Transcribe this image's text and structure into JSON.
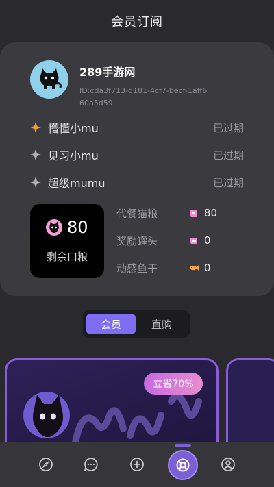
{
  "header": {
    "title": "会员订阅"
  },
  "profile": {
    "username": "289手游网",
    "user_id": "ID:cda3f713-d181-4cf7-becf-1aff660a5d59",
    "avatar_icon": "black-cat-avatar"
  },
  "tiers": [
    {
      "name": "懵懂小mu",
      "status": "已过期",
      "icon": "orange-star-icon"
    },
    {
      "name": "见习小mu",
      "status": "已过期",
      "icon": "grey-star-icon"
    },
    {
      "name": "超级mumu",
      "status": "已过期",
      "icon": "grey-star-icon"
    }
  ],
  "food": {
    "count": "80",
    "label": "剩余口粮"
  },
  "stats": [
    {
      "label": "代餐猫粮",
      "value": "80",
      "icon": "cat-food-icon"
    },
    {
      "label": "奖励罐头",
      "value": "0",
      "icon": "can-icon"
    },
    {
      "label": "动感鱼干",
      "value": "0",
      "icon": "fish-icon"
    }
  ],
  "tabs": {
    "active": "会员",
    "other": "直购"
  },
  "promo": {
    "badge": "立省70%"
  },
  "nav": {
    "items": [
      "compass-icon",
      "chat-icon",
      "plus-icon",
      "lifebuoy-icon",
      "profile-icon"
    ]
  },
  "colors": {
    "accent": "#7f6cf0",
    "badge_start": "#c76ae0",
    "badge_end": "#e88cd0",
    "star_orange": "#f0a030"
  }
}
